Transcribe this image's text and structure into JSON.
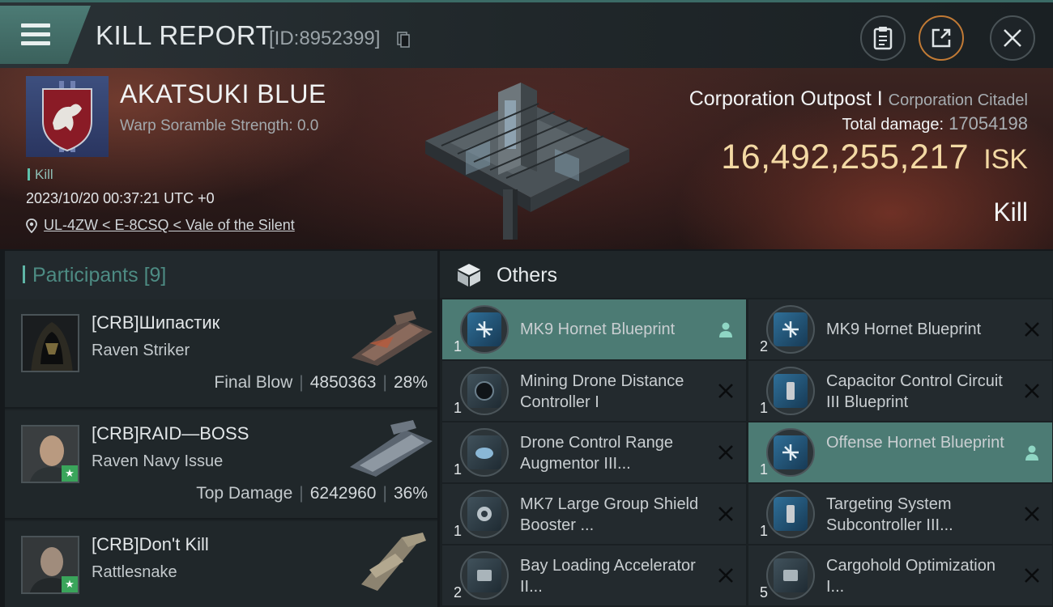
{
  "header": {
    "title": "KILL REPORT",
    "report_id": "[ID:8952399]"
  },
  "victim": {
    "name": "AKATSUKI BLUE",
    "warp_scramble": "Warp Soramble Strength: 0.0",
    "kill_tag": "Kill",
    "timestamp": "2023/10/20 00:37:21 UTC +0",
    "location": "UL-4ZW < E-8CSQ < Vale of the Silent"
  },
  "target": {
    "structure": "Corporation Outpost",
    "divider": "I",
    "structure_type": "Corporation Citadel",
    "damage_label": "Total damage:",
    "damage_value": "17054198",
    "isk_value": "16,492,255,217",
    "isk_unit": "ISK",
    "result": "Kill"
  },
  "participants": {
    "label": "Participants",
    "count": "[9]",
    "rows": [
      {
        "name": "[CRB]Шипастик",
        "ship": "Raven Striker",
        "role": "Final Blow",
        "damage": "4850363",
        "percent": "28%"
      },
      {
        "name": "[CRB]RAID—BOSS",
        "ship": "Raven Navy Issue",
        "role": "Top Damage",
        "damage": "6242960",
        "percent": "36%"
      },
      {
        "name": "[CRB]Don't Kill",
        "ship": "Rattlesnake"
      }
    ]
  },
  "others": {
    "label": "Others",
    "items": [
      {
        "qty": "1",
        "name": "MK9 Hornet Blueprint",
        "icon": "drone-blueprint-icon"
      },
      {
        "qty": "2",
        "name": "MK9 Hornet Blueprint",
        "icon": "drone-blueprint-icon"
      },
      {
        "qty": "1",
        "name": "Mining Drone Distance Controller I",
        "icon": "module-icon"
      },
      {
        "qty": "1",
        "name": "Capacitor Control Circuit III Blueprint",
        "icon": "rig-blueprint-icon"
      },
      {
        "qty": "1",
        "name": "Drone Control Range Augmentor III...",
        "icon": "module-icon"
      },
      {
        "qty": "1",
        "name": "Offense Hornet Blueprint",
        "icon": "drone-blueprint-icon"
      },
      {
        "qty": "1",
        "name": "MK7 Large Group Shield Booster ...",
        "icon": "module-icon"
      },
      {
        "qty": "1",
        "name": "Targeting System Subcontroller III...",
        "icon": "rig-blueprint-icon"
      },
      {
        "qty": "2",
        "name": "Bay Loading Accelerator II...",
        "icon": "module-icon"
      },
      {
        "qty": "5",
        "name": "Cargohold Optimization I...",
        "icon": "module-icon"
      }
    ]
  },
  "colors": {
    "accent": "#4c7b74",
    "isk": "#f3d9a4",
    "warning": "#c17a35"
  }
}
